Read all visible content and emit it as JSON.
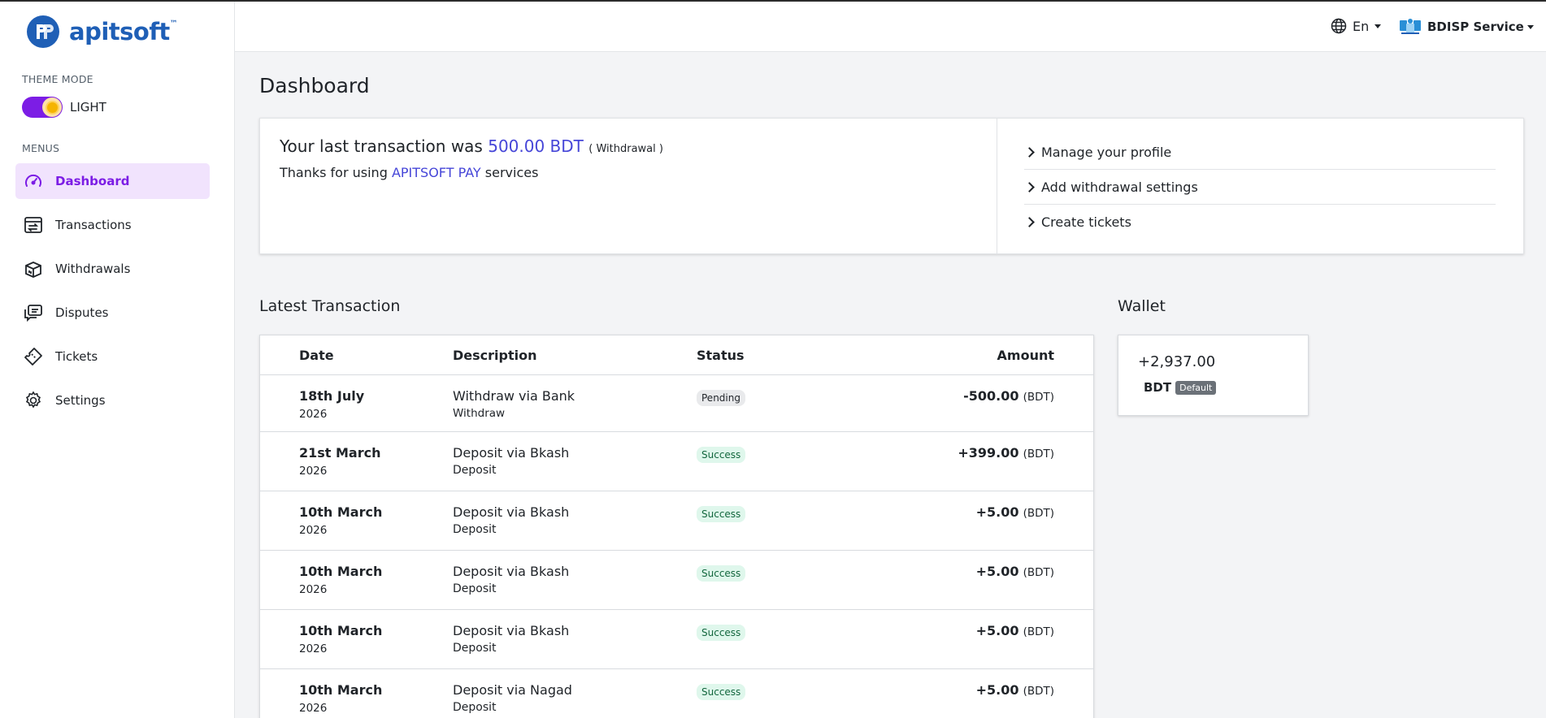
{
  "brand": {
    "logo_text": "apitsoft",
    "logo_tm": "™"
  },
  "sidebar": {
    "theme_label": "THEME MODE",
    "theme_value": "LIGHT",
    "menus_label": "MENUS",
    "items": [
      {
        "label": "Dashboard",
        "icon": "dashboard-gauge-icon",
        "active": true
      },
      {
        "label": "Transactions",
        "icon": "transactions-icon"
      },
      {
        "label": "Withdrawals",
        "icon": "withdrawals-icon"
      },
      {
        "label": "Disputes",
        "icon": "disputes-chat-icon"
      },
      {
        "label": "Tickets",
        "icon": "ticket-icon"
      },
      {
        "label": "Settings",
        "icon": "gear-icon"
      }
    ]
  },
  "header": {
    "language": "En",
    "account_name": "BDISP Service"
  },
  "page": {
    "title": "Dashboard"
  },
  "summary": {
    "prefix": "Your last transaction was",
    "amount": "500.00 BDT",
    "type": "( Withdrawal )",
    "thanks_prefix": "Thanks for using",
    "brand_name": "APITSOFT PAY",
    "thanks_suffix": "services",
    "links": [
      {
        "label": "Manage your profile"
      },
      {
        "label": "Add withdrawal settings"
      },
      {
        "label": "Create tickets"
      }
    ]
  },
  "latest": {
    "title": "Latest Transaction",
    "columns": {
      "date": "Date",
      "description": "Description",
      "status": "Status",
      "amount": "Amount"
    },
    "rows": [
      {
        "date": "18th July",
        "year": "2026",
        "desc": "Withdraw via Bank",
        "sub": "Withdraw",
        "status": "Pending",
        "amount": "-500.00",
        "unit": "(BDT)"
      },
      {
        "date": "21st March",
        "year": "2026",
        "desc": "Deposit via Bkash",
        "sub": "Deposit",
        "status": "Success",
        "amount": "+399.00",
        "unit": "(BDT)"
      },
      {
        "date": "10th March",
        "year": "2026",
        "desc": "Deposit via Bkash",
        "sub": "Deposit",
        "status": "Success",
        "amount": "+5.00",
        "unit": "(BDT)"
      },
      {
        "date": "10th March",
        "year": "2026",
        "desc": "Deposit via Bkash",
        "sub": "Deposit",
        "status": "Success",
        "amount": "+5.00",
        "unit": "(BDT)"
      },
      {
        "date": "10th March",
        "year": "2026",
        "desc": "Deposit via Bkash",
        "sub": "Deposit",
        "status": "Success",
        "amount": "+5.00",
        "unit": "(BDT)"
      },
      {
        "date": "10th March",
        "year": "2026",
        "desc": "Deposit via Nagad",
        "sub": "Deposit",
        "status": "Success",
        "amount": "+5.00",
        "unit": "(BDT)"
      }
    ]
  },
  "wallet": {
    "title": "Wallet",
    "balance": "+2,937.00",
    "currency": "BDT",
    "default_label": "Default"
  },
  "colors": {
    "accent": "#7c1de5",
    "link": "#4646d8",
    "brand_blue": "#1f5fb6",
    "active_bg": "#f1e3fd"
  }
}
